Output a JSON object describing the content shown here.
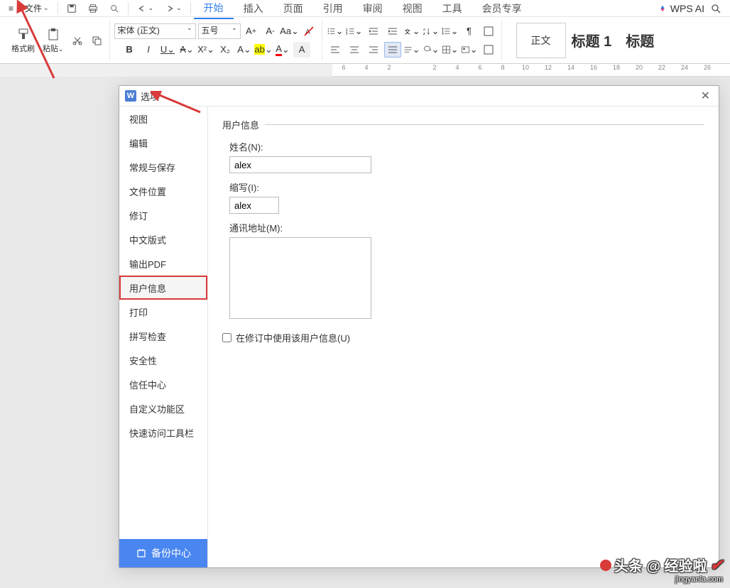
{
  "menu": {
    "file": "文件",
    "tabs": [
      "开始",
      "插入",
      "页面",
      "引用",
      "审阅",
      "视图",
      "工具",
      "会员专享"
    ],
    "activeTab": 0,
    "wps_ai": "WPS AI"
  },
  "ribbon": {
    "format_brush": "格式刷",
    "paste": "粘贴",
    "font_name": "宋体 (正文)",
    "font_size": "五号",
    "style_normal": "正文",
    "style_heading1": "标题 1",
    "style_heading_more": "标题"
  },
  "ruler": [
    "6",
    "4",
    "2",
    "",
    "2",
    "4",
    "6",
    "8",
    "10",
    "12",
    "14",
    "16",
    "18",
    "20",
    "22",
    "24",
    "26"
  ],
  "dialog": {
    "title": "选项",
    "sidebar": [
      "视图",
      "编辑",
      "常规与保存",
      "文件位置",
      "修订",
      "中文版式",
      "输出PDF",
      "用户信息",
      "打印",
      "拼写检查",
      "安全性",
      "信任中心",
      "自定义功能区",
      "快速访问工具栏"
    ],
    "selected_index": 7,
    "backup": "备份中心",
    "content": {
      "section": "用户信息",
      "name_label": "姓名(N):",
      "name_value": "alex",
      "initials_label": "缩写(I):",
      "initials_value": "alex",
      "address_label": "通讯地址(M):",
      "address_value": "",
      "checkbox": "在修订中使用该用户信息(U)"
    }
  },
  "watermark": {
    "text": "头条 @ 经验啦",
    "url": "jingyanla.com"
  }
}
